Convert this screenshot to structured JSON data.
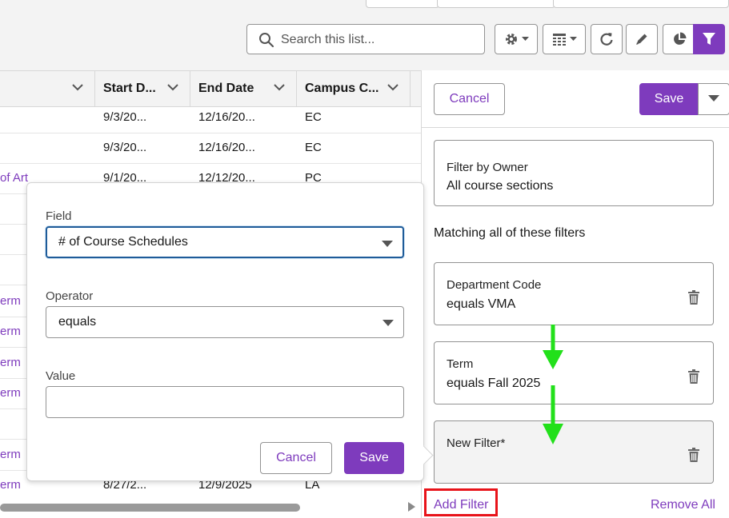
{
  "search": {
    "placeholder": "Search this list..."
  },
  "colors": {
    "brand": "#7e3bbd",
    "annotation_arrow": "#22e01a",
    "annotation_box": "#e8131a"
  },
  "table": {
    "headers": [
      "Start D...",
      "End Date",
      "Campus C..."
    ],
    "rows": [
      {
        "name": "",
        "start": "9/3/20...",
        "end": "12/16/20...",
        "campus": "EC"
      },
      {
        "name": "",
        "start": "9/3/20...",
        "end": "12/16/20...",
        "campus": "EC"
      },
      {
        "name": "of Art",
        "start": "9/1/20...",
        "end": "12/12/20...",
        "campus": "PC"
      },
      {
        "name": "",
        "start": "",
        "end": "",
        "campus": ""
      },
      {
        "name": "",
        "start": "",
        "end": "",
        "campus": ""
      },
      {
        "name": "",
        "start": "",
        "end": "",
        "campus": ""
      },
      {
        "name": "erm",
        "start": "",
        "end": "",
        "campus": ""
      },
      {
        "name": "erm",
        "start": "",
        "end": "",
        "campus": ""
      },
      {
        "name": "erm",
        "start": "",
        "end": "",
        "campus": ""
      },
      {
        "name": "erm",
        "start": "",
        "end": "",
        "campus": ""
      },
      {
        "name": "",
        "start": "",
        "end": "",
        "campus": ""
      },
      {
        "name": "erm",
        "start": "",
        "end": "",
        "campus": ""
      },
      {
        "name": "erm",
        "start": "8/27/2...",
        "end": "12/9/2025",
        "campus": "LA"
      }
    ]
  },
  "popover": {
    "field_label": "Field",
    "field_value": "# of Course Schedules",
    "operator_label": "Operator",
    "operator_value": "equals",
    "value_label": "Value",
    "value_value": "",
    "cancel_label": "Cancel",
    "save_label": "Save"
  },
  "panel": {
    "cancel_label": "Cancel",
    "save_label": "Save",
    "owner_title": "Filter by Owner",
    "owner_value": "All course sections",
    "matching_label": "Matching all of these filters",
    "filters": [
      {
        "title": "Department Code",
        "value": "equals VMA"
      },
      {
        "title": "Term",
        "value": "equals Fall 2025"
      },
      {
        "title": "New Filter*",
        "value": ""
      }
    ],
    "add_filter_label": "Add Filter",
    "remove_all_label": "Remove All"
  }
}
